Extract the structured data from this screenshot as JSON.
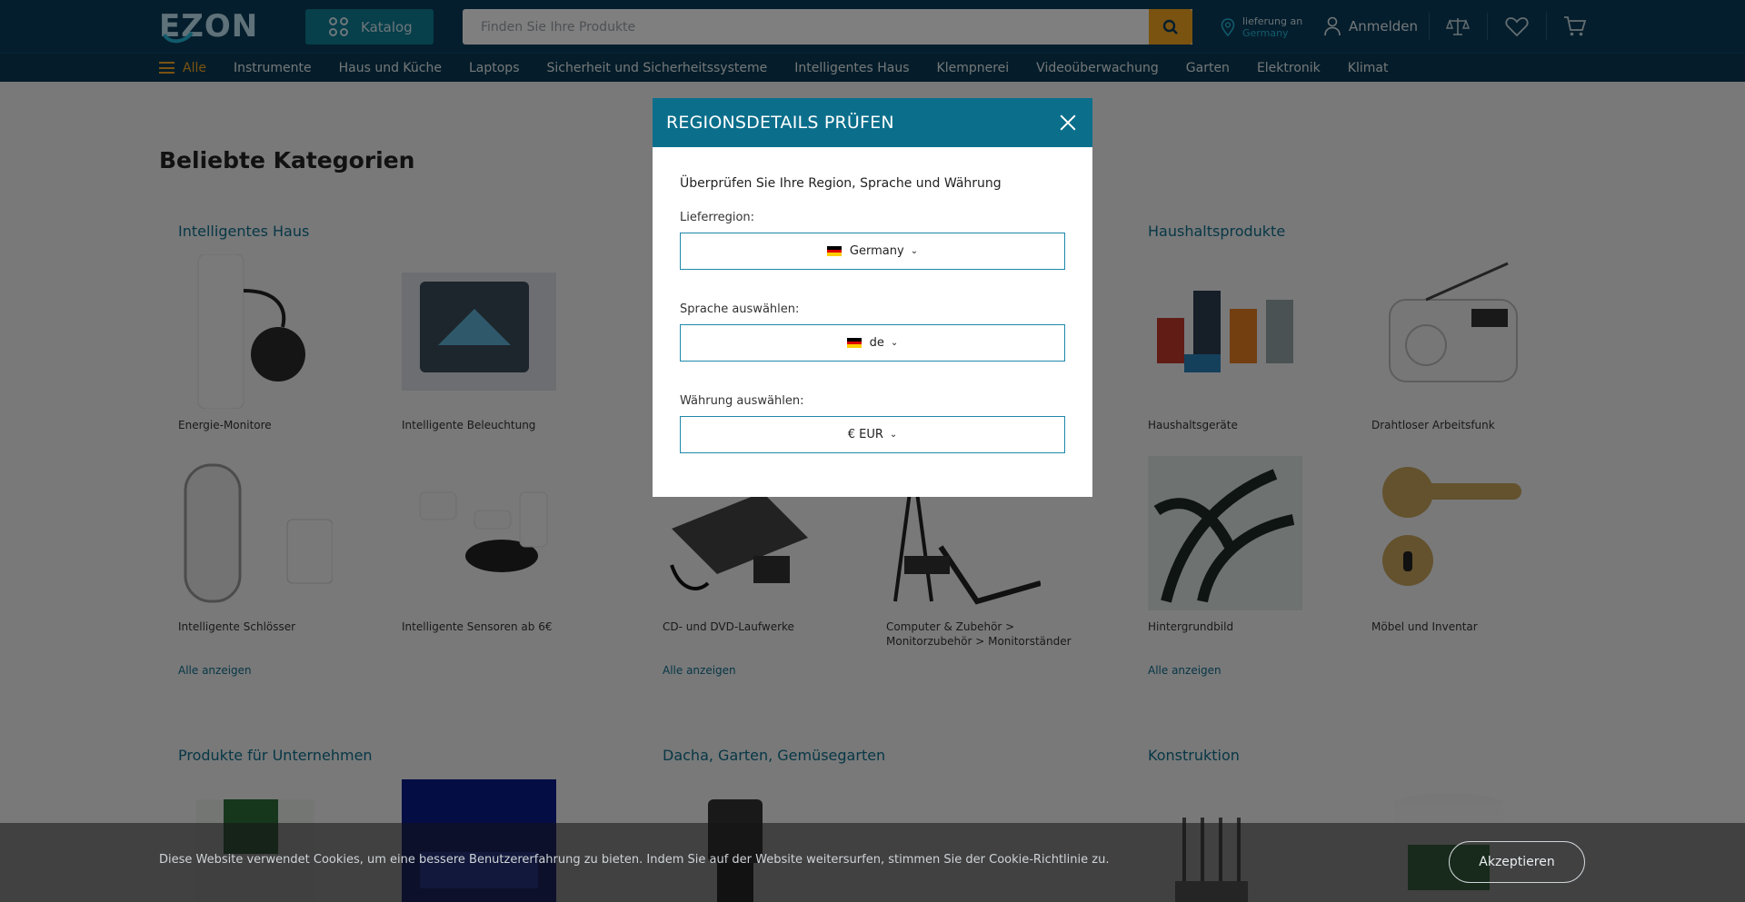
{
  "header": {
    "logo_text": "EZON",
    "catalog_label": "Katalog",
    "search_placeholder": "Finden Sie Ihre Produkte",
    "delivery_line1": "lieferung an",
    "delivery_line2": "Germany",
    "login_label": "Anmelden",
    "icons": [
      "search-icon",
      "location-pin-icon",
      "person-icon",
      "compare-scale-icon",
      "heart-icon",
      "cart-icon"
    ]
  },
  "nav": {
    "all_label": "Alle",
    "items": [
      "Instrumente",
      "Haus und Küche",
      "Laptops",
      "Sicherheit und Sicherheitssysteme",
      "Intelligentes Haus",
      "Klempnerei",
      "Videoüberwachung",
      "Garten",
      "Elektronik",
      "Klimat"
    ]
  },
  "main": {
    "title": "Beliebte Kategorien",
    "sections": [
      {
        "title": "Intelligentes Haus",
        "tiles": [
          "Energie-Monitore",
          "Intelligente Beleuchtung",
          "Intelligente Schlösser",
          "Intelligente Sensoren ab 6€"
        ],
        "show_all": "Alle anzeigen"
      },
      {
        "title": "",
        "tiles": [
          "CD- und DVD-Laufwerke",
          "Computer & Zubehör > Monitorzubehör > Monitorständer"
        ],
        "show_all": "Alle anzeigen"
      },
      {
        "title": "Haushaltsprodukte",
        "tiles": [
          "Haushaltsgeräte",
          "Drahtloser Arbeitsfunk",
          "Hintergrundbild",
          "Möbel und Inventar"
        ],
        "show_all": "Alle anzeigen"
      }
    ],
    "bottom_sections": [
      "Produkte für Unternehmen",
      "Dacha, Garten, Gemüsegarten",
      "Konstruktion"
    ]
  },
  "modal": {
    "title": "REGIONSDETAILS PRÜFEN",
    "description": "Überprüfen Sie Ihre Region, Sprache und Währung",
    "region_label": "Lieferregion:",
    "region_value": "Germany",
    "language_label": "Sprache auswählen:",
    "language_value": "de",
    "currency_label": "Währung auswählen:",
    "currency_value": "€ EUR"
  },
  "cookie": {
    "text": "Diese Website verwendet Cookies, um eine bessere Benutzererfahrung zu bieten. Indem Sie auf der Website weitersurfen, stimmen Sie der Cookie-Richtlinie zu.",
    "accept_label": "Akzeptieren"
  },
  "colors": {
    "header_bg": "#0a3d5a",
    "accent_teal": "#0b6f8c",
    "accent_orange": "#f5a623",
    "link": "#0f6e8a"
  }
}
